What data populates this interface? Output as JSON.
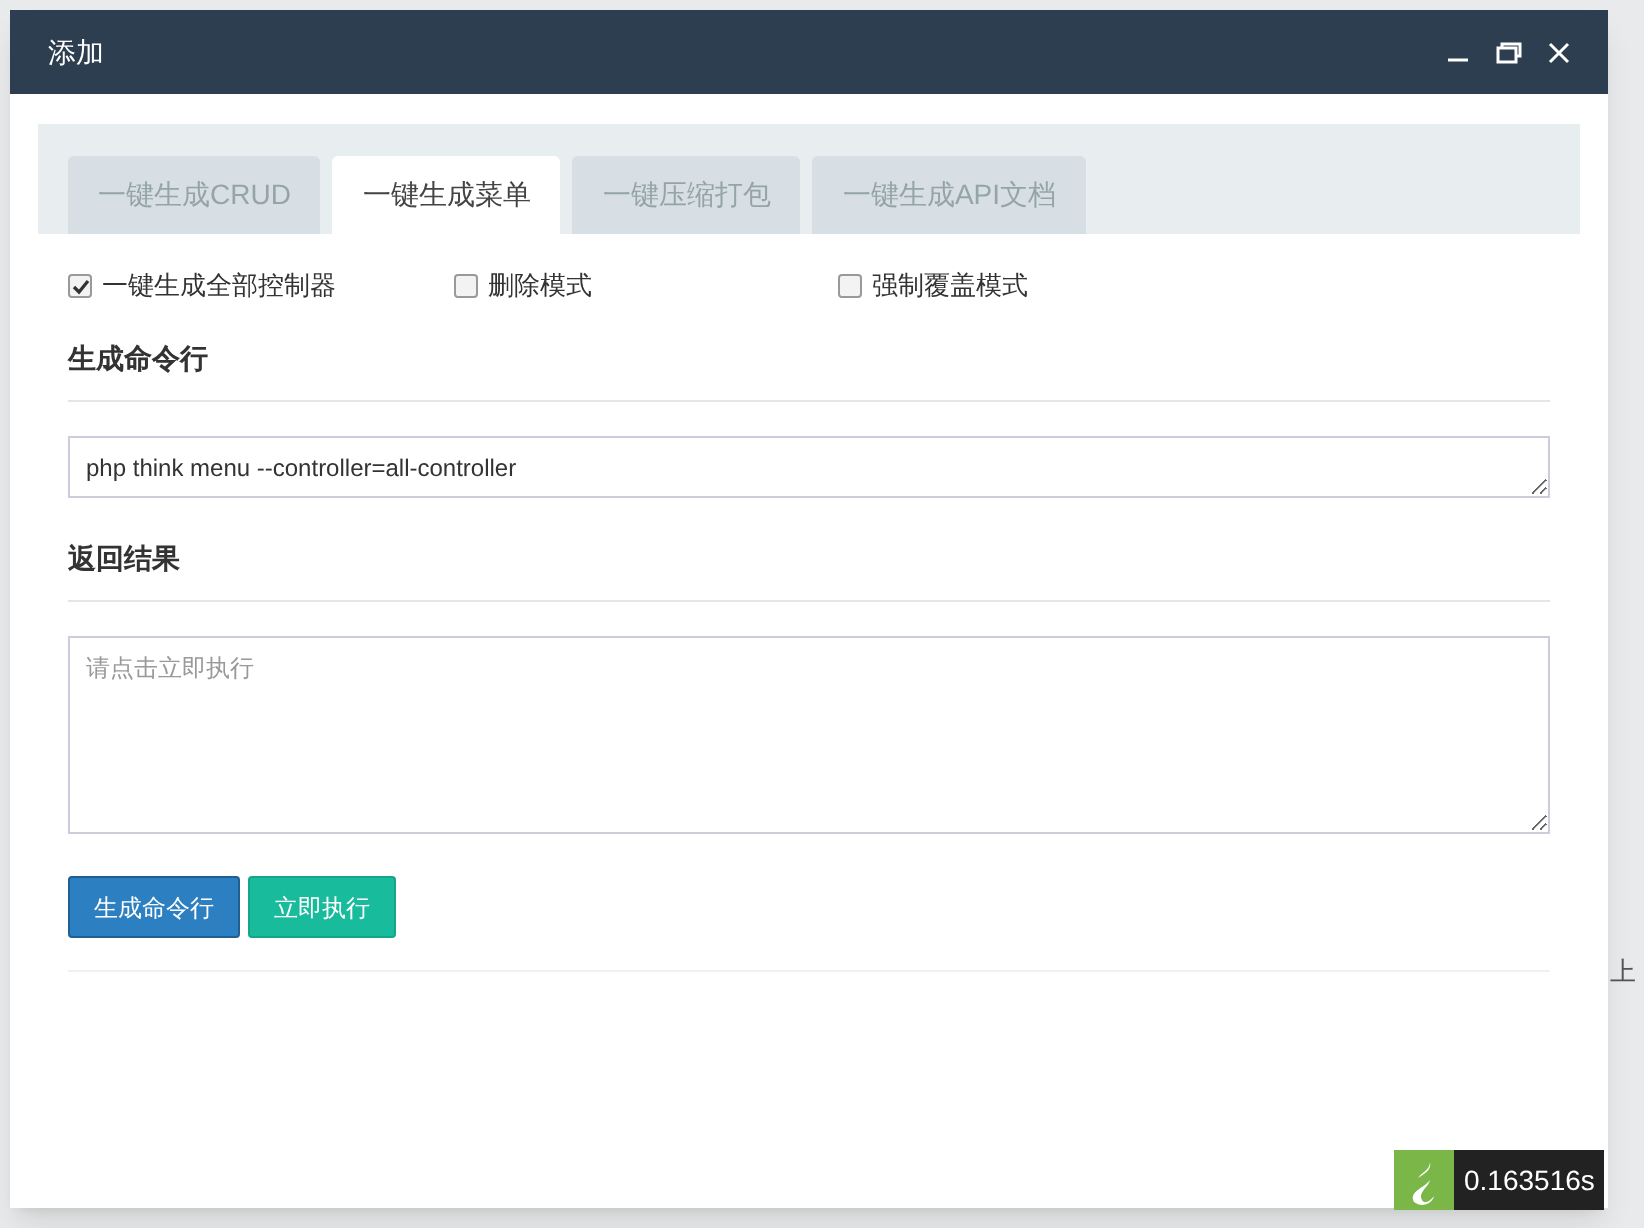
{
  "background": {
    "pager_text": "上"
  },
  "dialog": {
    "title": "添加",
    "tabs": [
      {
        "label": "一键生成CRUD",
        "selected": false
      },
      {
        "label": "一键生成菜单",
        "selected": true
      },
      {
        "label": "一键压缩打包",
        "selected": false
      },
      {
        "label": "一键生成API文档",
        "selected": false
      }
    ],
    "options": [
      {
        "label": "一键生成全部控制器",
        "checked": true
      },
      {
        "label": "删除模式",
        "checked": false
      },
      {
        "label": "强制覆盖模式",
        "checked": false
      }
    ],
    "command_heading": "生成命令行",
    "command_value": "php think menu --controller=all-controller",
    "result_heading": "返回结果",
    "result_placeholder": "请点击立即执行",
    "buttons": [
      {
        "label": "生成命令行",
        "kind": "primary"
      },
      {
        "label": "立即执行",
        "kind": "success"
      }
    ]
  },
  "debug_badge": {
    "time": "0.163516s"
  }
}
